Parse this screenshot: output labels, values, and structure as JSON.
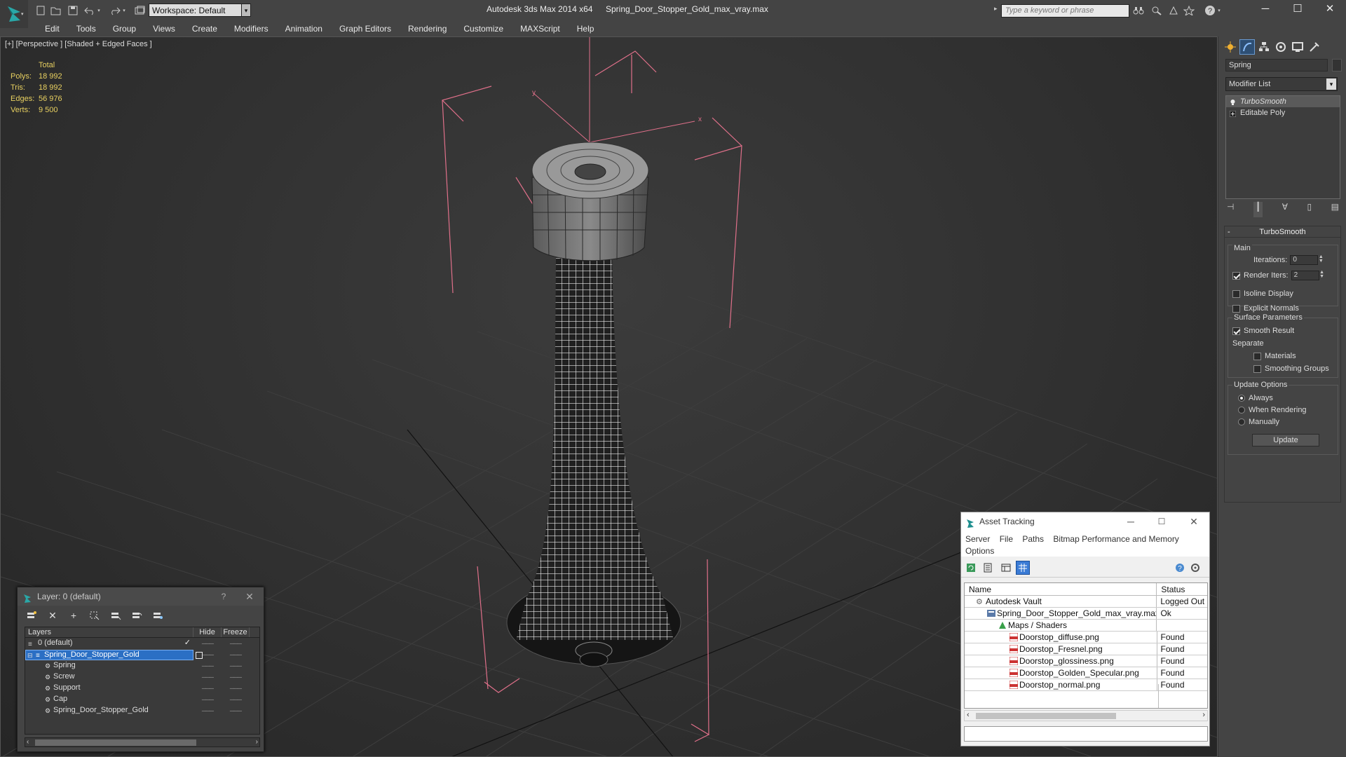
{
  "app": {
    "title": "Autodesk 3ds Max  2014 x64",
    "file": "Spring_Door_Stopper_Gold_max_vray.max",
    "workspace": "Workspace: Default",
    "search_placeholder": "Type a keyword or phrase"
  },
  "menu": [
    "Edit",
    "Tools",
    "Group",
    "Views",
    "Create",
    "Modifiers",
    "Animation",
    "Graph Editors",
    "Rendering",
    "Customize",
    "MAXScript",
    "Help"
  ],
  "viewport": {
    "label": "[+] [Perspective ] [Shaded + Edged Faces ]",
    "stats": {
      "header": "Total",
      "polys_label": "Polys:",
      "polys": "18 992",
      "tris_label": "Tris:",
      "tris": "18 992",
      "edges_label": "Edges:",
      "edges": "56 976",
      "verts_label": "Verts:",
      "verts": "9 500"
    },
    "axis_x": "x",
    "axis_y": "y"
  },
  "command_panel": {
    "object_name": "Spring",
    "modifier_list": "Modifier List",
    "stack": [
      "TurboSmooth",
      "Editable Poly"
    ],
    "turbosmooth": {
      "title": "TurboSmooth",
      "main": "Main",
      "iterations_label": "Iterations:",
      "iterations": "0",
      "render_iters_label": "Render Iters:",
      "render_iters": "2",
      "isoline": "Isoline Display",
      "explicit_normals": "Explicit Normals",
      "surface_params": "Surface Parameters",
      "smooth_result": "Smooth Result",
      "separate": "Separate",
      "materials": "Materials",
      "smoothing_groups": "Smoothing Groups",
      "update_options": "Update Options",
      "always": "Always",
      "when_rendering": "When Rendering",
      "manually": "Manually",
      "update": "Update"
    }
  },
  "layer_dialog": {
    "title": "Layer: 0 (default)",
    "help": "?",
    "columns": [
      "Layers",
      "Hide",
      "Freeze"
    ],
    "rows": [
      {
        "name": "0 (default)",
        "indent": 1,
        "selected": false
      },
      {
        "name": "Spring_Door_Stopper_Gold",
        "indent": 1,
        "selected": true
      },
      {
        "name": "Spring",
        "indent": 2,
        "selected": false
      },
      {
        "name": "Screw",
        "indent": 2,
        "selected": false
      },
      {
        "name": "Support",
        "indent": 2,
        "selected": false
      },
      {
        "name": "Cap",
        "indent": 2,
        "selected": false
      },
      {
        "name": "Spring_Door_Stopper_Gold",
        "indent": 2,
        "selected": false
      }
    ]
  },
  "asset_tracking": {
    "title": "Asset Tracking",
    "menu": [
      "Server",
      "File",
      "Paths",
      "Bitmap Performance and Memory",
      "Options"
    ],
    "columns": [
      "Name",
      "Status"
    ],
    "rows": [
      {
        "name": "Autodesk Vault",
        "status": "Logged Out",
        "indent": 1
      },
      {
        "name": "Spring_Door_Stopper_Gold_max_vray.max",
        "status": "Ok",
        "indent": 2
      },
      {
        "name": "Maps / Shaders",
        "status": "",
        "indent": 3
      },
      {
        "name": "Doorstop_diffuse.png",
        "status": "Found",
        "indent": 4
      },
      {
        "name": "Doorstop_Fresnel.png",
        "status": "Found",
        "indent": 4
      },
      {
        "name": "Doorstop_glossiness.png",
        "status": "Found",
        "indent": 4
      },
      {
        "name": "Doorstop_Golden_Specular.png",
        "status": "Found",
        "indent": 4
      },
      {
        "name": "Doorstop_normal.png",
        "status": "Found",
        "indent": 4
      }
    ]
  }
}
